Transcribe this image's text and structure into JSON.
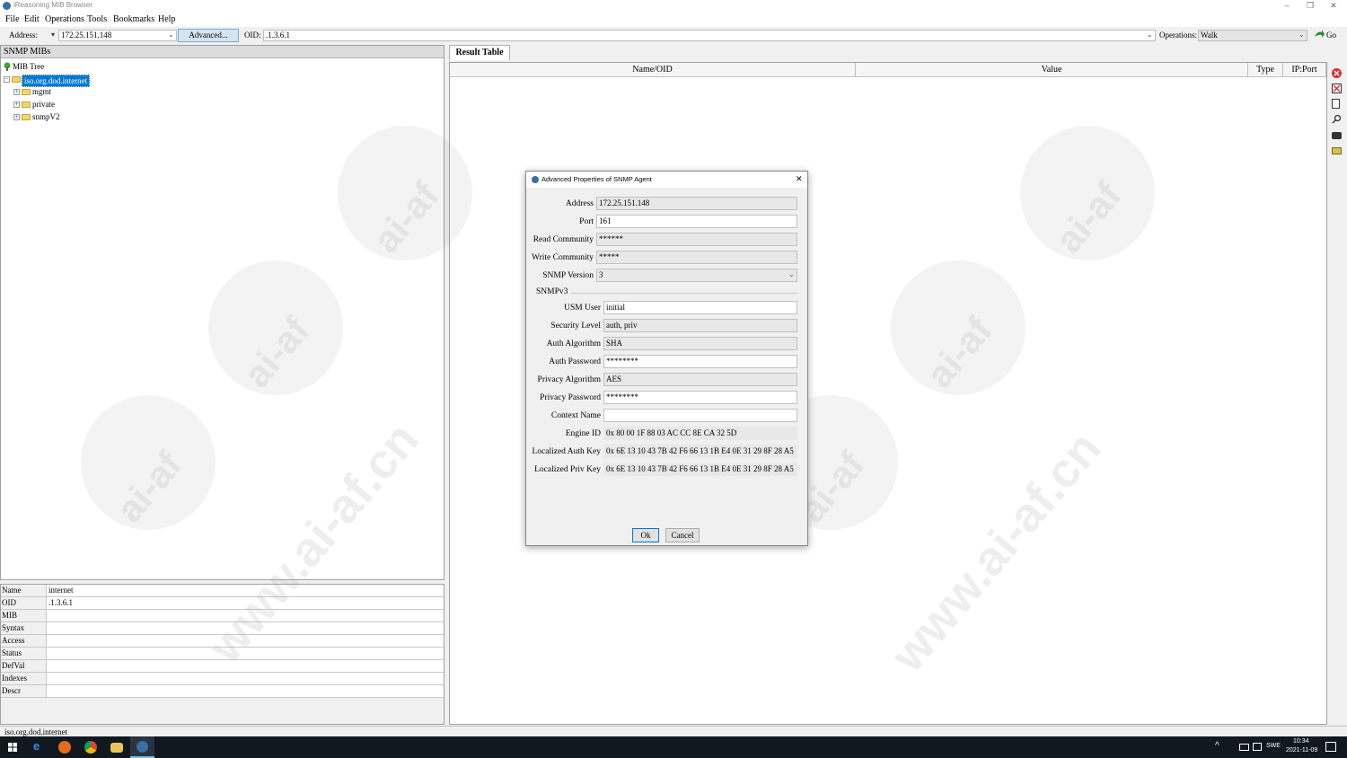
{
  "window": {
    "title": "iReasoning MIB Browser",
    "minimize": "–",
    "maximize": "❐",
    "close": "✕"
  },
  "menu": [
    "File",
    "Edit",
    "Operations",
    "Tools",
    "Bookmarks",
    "Help"
  ],
  "addressbar": {
    "address_label": "Address:",
    "address_value": "172.25.151.148",
    "advanced_label": "Advanced...",
    "oid_label": "OID:",
    "oid_value": ".1.3.6.1",
    "operations_label": "Operations:",
    "operation_value": "Walk",
    "go_label": "Go"
  },
  "mib": {
    "header": "SNMP MIBs",
    "root": "MIB Tree",
    "selected": "iso.org.dod.internet",
    "children": [
      "mgmt",
      "private",
      "snmpV2"
    ]
  },
  "properties": {
    "rows": [
      {
        "name": "Name",
        "value": "internet"
      },
      {
        "name": "OID",
        "value": ".1.3.6.1"
      },
      {
        "name": "MIB",
        "value": ""
      },
      {
        "name": "Syntax",
        "value": ""
      },
      {
        "name": "Access",
        "value": ""
      },
      {
        "name": "Status",
        "value": ""
      },
      {
        "name": "DefVal",
        "value": ""
      },
      {
        "name": "Indexes",
        "value": ""
      },
      {
        "name": "Descr",
        "value": ""
      }
    ]
  },
  "status": {
    "text": "iso.org.dod.internet"
  },
  "result": {
    "tab": "Result Table",
    "columns": [
      "Name/OID",
      "Value",
      "Type",
      "IP:Port"
    ]
  },
  "sidetools": [
    "stop-icon",
    "clear-icon",
    "save-icon",
    "find-icon",
    "export-icon",
    "open-icon"
  ],
  "dialog": {
    "title": "Advanced Properties of SNMP Agent",
    "close": "✕",
    "fields": {
      "address": {
        "label": "Address",
        "value": "172.25.151.148"
      },
      "port": {
        "label": "Port",
        "value": "161"
      },
      "read_community": {
        "label": "Read Community",
        "value": "******"
      },
      "write_community": {
        "label": "Write Community",
        "value": "*****"
      },
      "snmp_version": {
        "label": "SNMP Version",
        "value": "3"
      }
    },
    "snmpv3_section": "SNMPv3",
    "v3": {
      "usm_user": {
        "label": "USM User",
        "value": "initial"
      },
      "security_level": {
        "label": "Security Level",
        "value": "auth, priv"
      },
      "auth_algorithm": {
        "label": "Auth Algorithm",
        "value": "SHA"
      },
      "auth_password": {
        "label": "Auth Password",
        "value": "********"
      },
      "privacy_algorithm": {
        "label": "Privacy Algorithm",
        "value": "AES"
      },
      "privacy_password": {
        "label": "Privacy Password",
        "value": "********"
      },
      "context_name": {
        "label": "Context Name",
        "value": ""
      },
      "engine_id": {
        "label": "Engine ID",
        "value": "0x 80 00 1F 88 03 AC CC 8E CA 32 5D"
      },
      "localized_auth_key": {
        "label": "Localized Auth Key",
        "value": "0x 6E 13 10 43 7B 42 F6 66 13 1B E4 0E 31 29 8F 28 A5"
      },
      "localized_priv_key": {
        "label": "Localized Priv Key",
        "value": "0x 6E 13 10 43 7B 42 F6 66 13 1B E4 0E 31 29 8F 28 A5"
      }
    },
    "ok_label": "Ok",
    "cancel_label": "Cancel"
  },
  "taskbar": {
    "time": "10:34",
    "date": "2021-11-09",
    "lang": "SWE",
    "up_arrow": "^"
  },
  "watermark": {
    "text1": "ai-af",
    "text2": "www.ai-af.cn"
  }
}
